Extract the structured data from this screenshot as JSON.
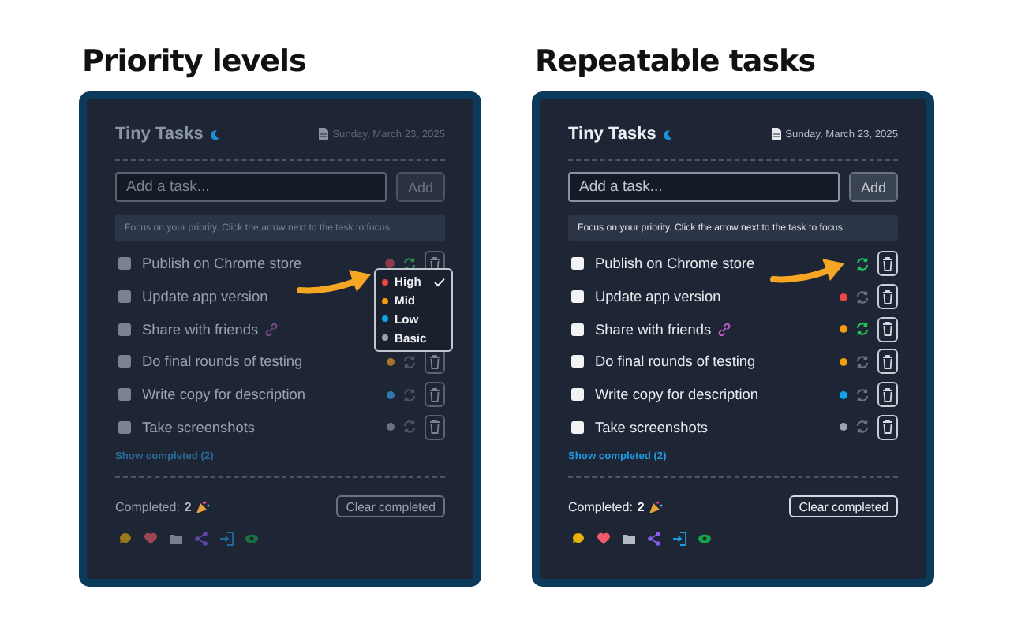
{
  "panels": [
    {
      "heading": "Priority levels",
      "dimmed": true,
      "title": "Tiny Tasks",
      "date": "Sunday, March 23, 2025",
      "input": {
        "placeholder": "Add a task..."
      },
      "add_button": "Add",
      "hint": "Focus on your priority. Click the arrow next to the task to focus.",
      "tasks": [
        {
          "text": "Publish on Chrome store",
          "checked": false,
          "link": false,
          "color": "#8c3a4e",
          "repeat": true
        },
        {
          "text": "Update app version",
          "checked": false,
          "link": false
        },
        {
          "text": "Share with friends",
          "checked": false,
          "link": true
        },
        {
          "text": "Do final rounds of testing",
          "checked": false,
          "link": false,
          "color": "#a8742a",
          "repeat": false
        },
        {
          "text": "Write copy for description",
          "checked": false,
          "link": false,
          "color": "#2f78ad",
          "repeat": false
        },
        {
          "text": "Take screenshots",
          "checked": false,
          "link": false,
          "color": "#6b7280",
          "repeat": false
        }
      ],
      "menu": [
        {
          "label": "High",
          "color": "#ef4444",
          "selected": true
        },
        {
          "label": "Mid",
          "color": "#f59e0b",
          "selected": false
        },
        {
          "label": "Low",
          "color": "#0ea5e9",
          "selected": false
        },
        {
          "label": "Basic",
          "color": "#9ca3af",
          "selected": false
        }
      ],
      "show_completed": "Show completed (2)",
      "completed_label": "Completed:",
      "completed_count": "2",
      "clear_button": "Clear completed"
    },
    {
      "heading": "Repeatable tasks",
      "dimmed": false,
      "title": "Tiny Tasks",
      "date": "Sunday, March 23, 2025",
      "input": {
        "placeholder": "Add a task..."
      },
      "add_button": "Add",
      "hint": "Focus on your priority. Click the arrow next to the task to focus.",
      "tasks": [
        {
          "text": "Publish on Chrome store",
          "checked": false,
          "link": false,
          "repeat": true
        },
        {
          "text": "Update app version",
          "checked": false,
          "link": false,
          "color": "#ef4444",
          "repeat": false
        },
        {
          "text": "Share with friends",
          "checked": false,
          "link": true,
          "color": "#f59e0b",
          "repeat": true
        },
        {
          "text": "Do final rounds of testing",
          "checked": false,
          "link": false,
          "color": "#f59e0b",
          "repeat": false
        },
        {
          "text": "Write copy for description",
          "checked": false,
          "link": false,
          "color": "#0ea5e9",
          "repeat": false
        },
        {
          "text": "Take screenshots",
          "checked": false,
          "link": false,
          "color": "#9ca3af",
          "repeat": false
        }
      ],
      "show_completed": "Show completed (2)",
      "completed_label": "Completed:",
      "completed_count": "2",
      "clear_button": "Clear completed"
    }
  ]
}
